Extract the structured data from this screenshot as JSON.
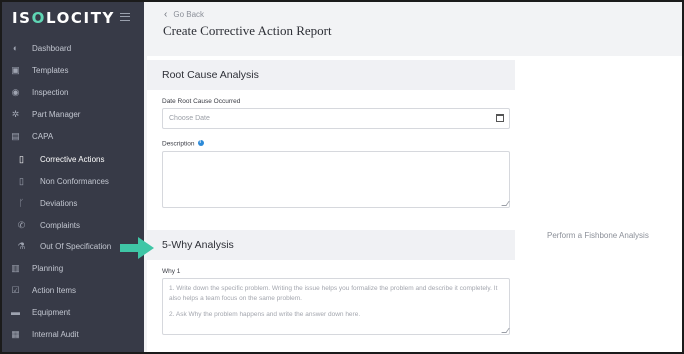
{
  "app": {
    "logo_left": "IS",
    "logo_accent": "O",
    "logo_right": "LOCITY"
  },
  "sidebar": {
    "items": [
      {
        "label": "Dashboard",
        "icon": "dashboard-icon",
        "glyph": "◐"
      },
      {
        "label": "Templates",
        "icon": "image-icon",
        "glyph": "▣"
      },
      {
        "label": "Inspection",
        "icon": "eye-icon",
        "glyph": "◉"
      },
      {
        "label": "Part Manager",
        "icon": "gear-icon",
        "glyph": "✲"
      },
      {
        "label": "CAPA",
        "icon": "medkit-icon",
        "glyph": "▤"
      },
      {
        "label": "Corrective Actions",
        "icon": "clipboard-icon",
        "glyph": "▯",
        "sub": true,
        "active": true
      },
      {
        "label": "Non Conformances",
        "icon": "file-icon",
        "glyph": "▯",
        "sub": true
      },
      {
        "label": "Deviations",
        "icon": "branch-icon",
        "glyph": "ᚴ",
        "sub": true
      },
      {
        "label": "Complaints",
        "icon": "phone-icon",
        "glyph": "✆",
        "sub": true
      },
      {
        "label": "Out Of Specification",
        "icon": "flask-icon",
        "glyph": "⚗",
        "sub": true
      },
      {
        "label": "Planning",
        "icon": "map-icon",
        "glyph": "▥"
      },
      {
        "label": "Action Items",
        "icon": "checkbox-icon",
        "glyph": "☑"
      },
      {
        "label": "Equipment",
        "icon": "truck-icon",
        "glyph": "▬"
      },
      {
        "label": "Internal Audit",
        "icon": "audit-icon",
        "glyph": "▦"
      }
    ]
  },
  "header": {
    "go_back": "Go Back",
    "title": "Create Corrective Action Report"
  },
  "root_cause": {
    "heading": "Root Cause Analysis",
    "date_label": "Date Root Cause Occurred",
    "date_placeholder": "Choose Date",
    "description_label": "Description"
  },
  "five_why": {
    "heading": "5-Why Analysis",
    "why_label": "Why 1",
    "placeholder_line1": "1. Write down the specific problem. Writing the issue helps you formalize the problem and describe it completely. It also helps a team focus on the same problem.",
    "placeholder_line2": "2. Ask Why the problem happens and write the answer down here."
  },
  "fishbone_link": "Perform a Fishbone Analysis",
  "colors": {
    "sidebar_bg": "#373a47",
    "logo_accent": "#5fd6b5",
    "pointer": "#3fc6a6"
  }
}
